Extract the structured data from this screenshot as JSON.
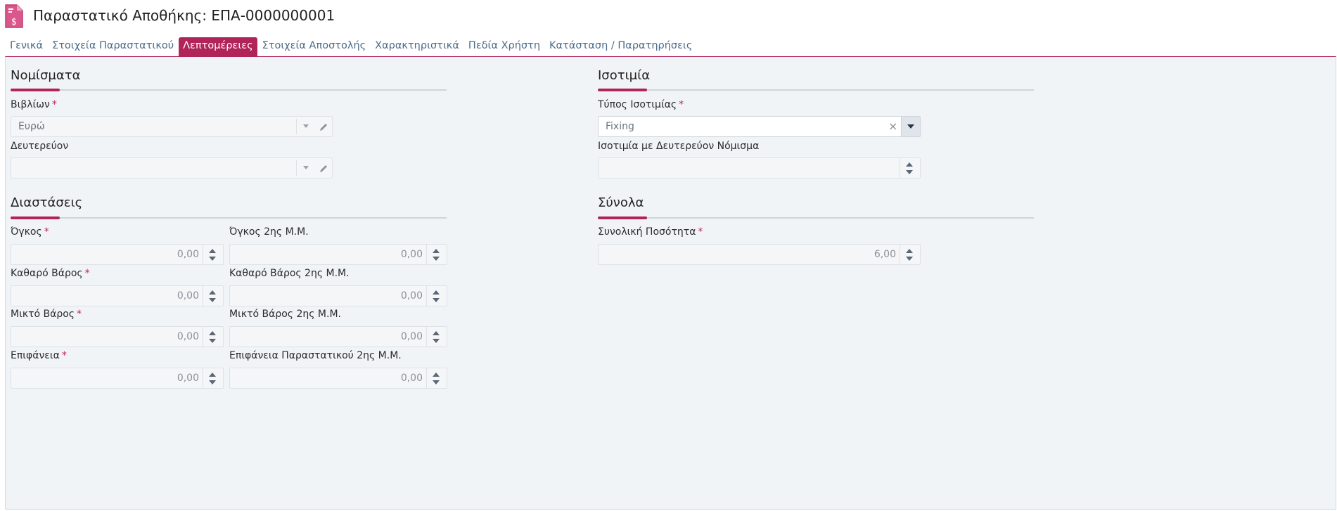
{
  "header": {
    "title": "Παραστατικό Αποθήκης: ΕΠΑ-0000000001"
  },
  "tabs": [
    {
      "label": "Γενικά"
    },
    {
      "label": "Στοιχεία Παραστατικού"
    },
    {
      "label": "Λεπτομέρειες"
    },
    {
      "label": "Στοιχεία Αποστολής"
    },
    {
      "label": "Χαρακτηριστικά"
    },
    {
      "label": "Πεδία Χρήστη"
    },
    {
      "label": "Κατάσταση / Παρατηρήσεις"
    }
  ],
  "active_tab": "Λεπτομέρειες",
  "colors": {
    "accent": "#b0245a",
    "panel_bg": "#f1f4f7"
  },
  "currencies": {
    "title": "Νομίσματα",
    "books": {
      "label": "Βιβλίων",
      "value": "Ευρώ",
      "required": "*"
    },
    "secondary": {
      "label": "Δευτερεύον",
      "value": ""
    }
  },
  "dimensions": {
    "title": "Διαστάσεις",
    "volume": {
      "label": "Όγκος",
      "value": "0,00",
      "required": "*"
    },
    "volume2": {
      "label": "Όγκος 2ης Μ.Μ.",
      "value": "0,00"
    },
    "net_weight": {
      "label": "Καθαρό Βάρος",
      "value": "0,00",
      "required": "*"
    },
    "net_weight2": {
      "label": "Καθαρό Βάρος 2ης Μ.Μ.",
      "value": "0,00"
    },
    "gross_weight": {
      "label": "Μικτό Βάρος",
      "value": "0,00",
      "required": "*"
    },
    "gross_weight2": {
      "label": "Μικτό Βάρος 2ης Μ.Μ.",
      "value": "0,00"
    },
    "surface": {
      "label": "Επιφάνεια",
      "value": "0,00",
      "required": "*"
    },
    "surface2": {
      "label": "Επιφάνεια Παραστατικού 2ης Μ.Μ.",
      "value": "0,00"
    }
  },
  "exchange": {
    "title": "Ισοτιμία",
    "type": {
      "label": "Τύπος Ισοτιμίας",
      "value": "Fixing",
      "required": "*",
      "clear": "×"
    },
    "rate": {
      "label": "Ισοτιμία με Δευτερεύον Νόμισμα",
      "value": ""
    }
  },
  "totals": {
    "title": "Σύνολα",
    "quantity": {
      "label": "Συνολική Ποσότητα",
      "value": "6,00",
      "required": "*"
    }
  }
}
